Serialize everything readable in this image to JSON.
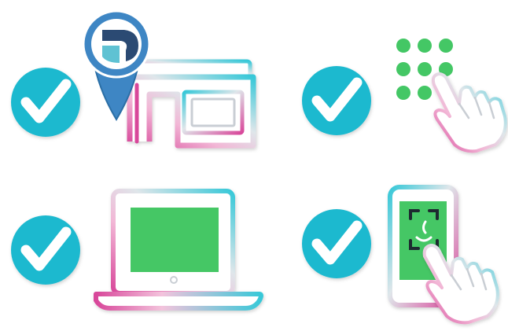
{
  "colors": {
    "background": "#ffffff",
    "check_badge": "#1fb9cf",
    "check_mark": "#ffffff",
    "screen_green": "#44c765",
    "pin_blue": "#3e86c4",
    "pin_dark": "#2b4a73",
    "pin_teal": "#5fc2d3",
    "outline_cyan": "#37c8d8",
    "outline_pink": "#d8479a",
    "outline_gray": "#c9ced4"
  },
  "icons": [
    {
      "name": "storefront-location-icon",
      "checked": true
    },
    {
      "name": "keypad-touch-icon",
      "checked": true
    },
    {
      "name": "laptop-screen-icon",
      "checked": true
    },
    {
      "name": "smartphone-face-scan-icon",
      "checked": true
    }
  ]
}
